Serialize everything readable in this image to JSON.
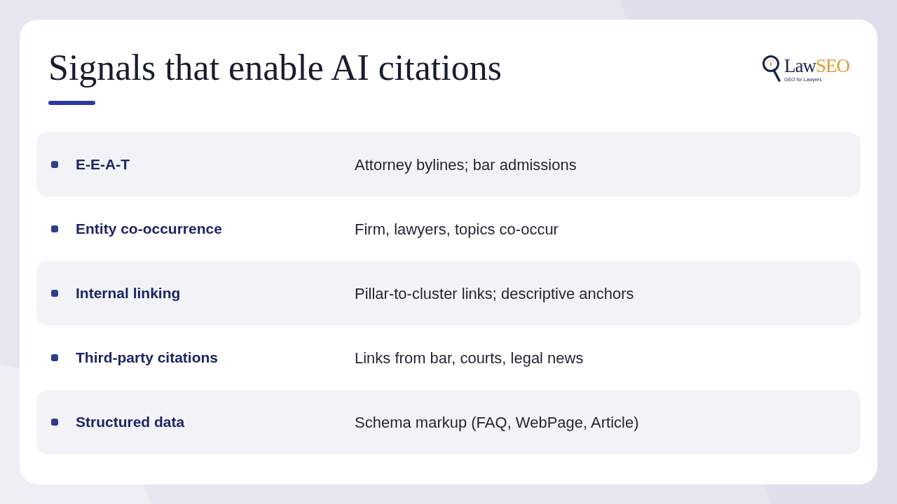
{
  "title": "Signals that enable AI citations",
  "logo": {
    "name_part_1": "Law",
    "name_part_2": "SEO",
    "tagline": "GEO for Lawyers"
  },
  "signals": [
    {
      "name": "E-E-A-T",
      "description": "Attorney bylines; bar admissions"
    },
    {
      "name": "Entity co-occurrence",
      "description": "Firm, lawyers, topics co-occur"
    },
    {
      "name": "Internal linking",
      "description": "Pillar-to-cluster links; descriptive anchors"
    },
    {
      "name": "Third-party citations",
      "description": "Links from bar, courts, legal news"
    },
    {
      "name": "Structured data",
      "description": "Schema markup (FAQ, WebPage, Article)"
    }
  ]
}
